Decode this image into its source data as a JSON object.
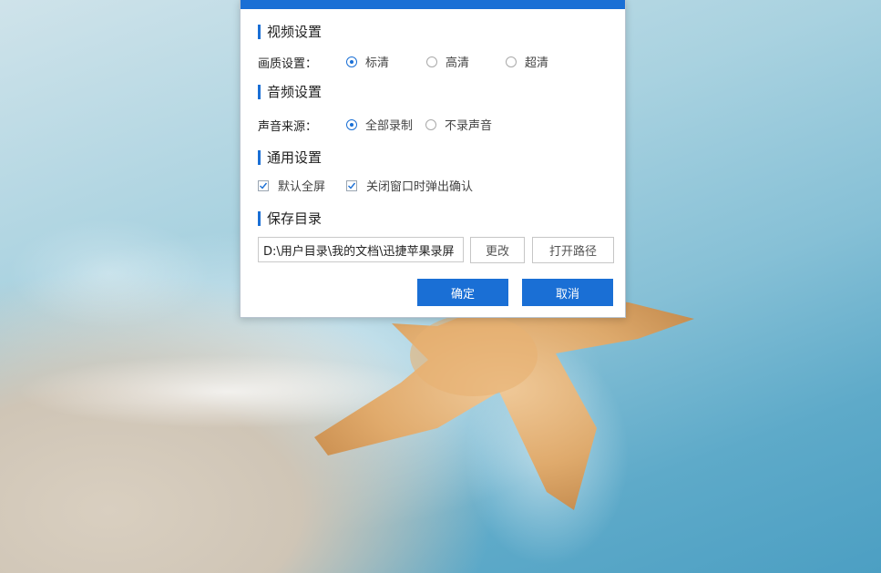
{
  "video_settings": {
    "title": "视频设置",
    "quality_label": "画质设置：",
    "options": [
      {
        "label": "标清",
        "selected": true
      },
      {
        "label": "高清",
        "selected": false
      },
      {
        "label": "超清",
        "selected": false
      }
    ]
  },
  "audio_settings": {
    "title": "音频设置",
    "source_label": "声音来源：",
    "options": [
      {
        "label": "全部录制",
        "selected": true
      },
      {
        "label": "不录声音",
        "selected": false
      }
    ]
  },
  "general_settings": {
    "title": "通用设置",
    "checkboxes": [
      {
        "label": "默认全屏",
        "checked": true
      },
      {
        "label": "关闭窗口时弹出确认",
        "checked": true
      }
    ]
  },
  "save_directory": {
    "title": "保存目录",
    "path_value": "D:\\用户目录\\我的文档\\迅捷苹果录屏",
    "change_label": "更改",
    "open_path_label": "打开路径"
  },
  "footer": {
    "confirm_label": "确定",
    "cancel_label": "取消"
  },
  "colors": {
    "accent": "#1a6fd5"
  }
}
